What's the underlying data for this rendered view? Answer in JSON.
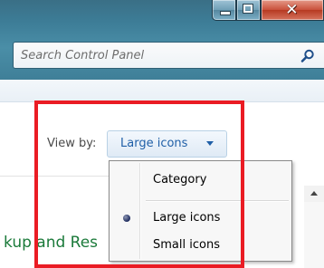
{
  "window": {
    "minimize_icon": "minimize-icon",
    "maximize_icon": "maximize-icon",
    "close_icon": "close-icon"
  },
  "search": {
    "placeholder": "Search Control Panel",
    "value": "",
    "icon": "search-icon"
  },
  "toolbar": {
    "view_by_label": "View by:",
    "view_by_value": "Large icons"
  },
  "menu": {
    "items": [
      {
        "label": "Category",
        "selected": false
      },
      {
        "label": "Large icons",
        "selected": true
      },
      {
        "label": "Small icons",
        "selected": false
      }
    ]
  },
  "content": {
    "partial_link": "kup and Res"
  },
  "colors": {
    "highlight": "#ea1c24",
    "link": "#1f5fa7",
    "category_link": "#1b7a3a"
  }
}
